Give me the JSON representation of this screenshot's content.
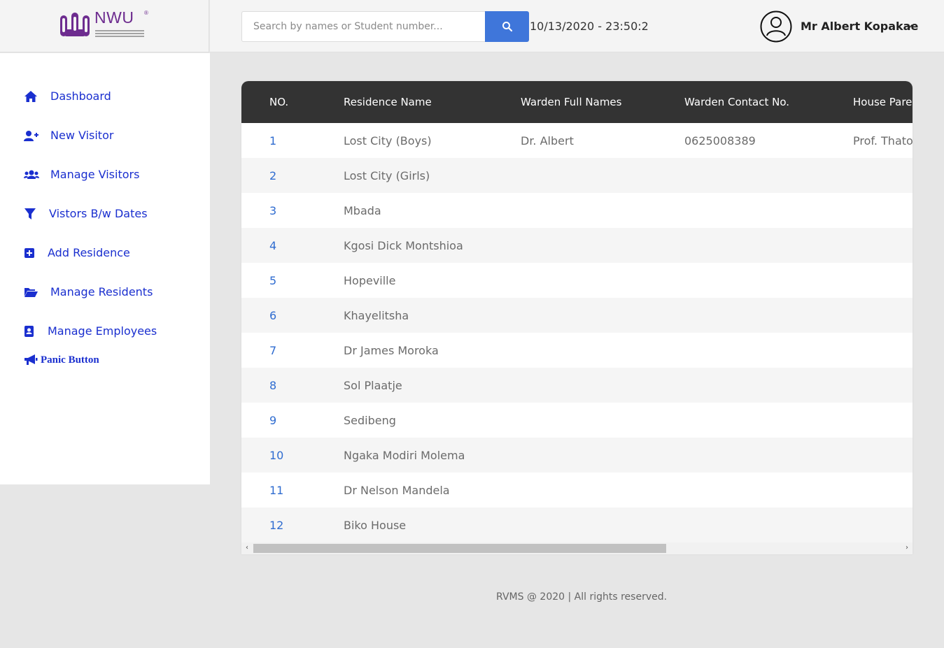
{
  "brand": {
    "name": "NWU",
    "reg_mark": "®"
  },
  "search": {
    "placeholder": "Search by names or Student number..."
  },
  "header": {
    "datetime": "10/13/2020 - 23:50:2",
    "user_name": "Mr Albert Kopakae"
  },
  "sidebar": {
    "items": [
      {
        "label": "Dashboard",
        "icon": "home-icon"
      },
      {
        "label": "New Visitor",
        "icon": "user-plus-icon"
      },
      {
        "label": "Manage Visitors",
        "icon": "users-icon"
      },
      {
        "label": "Vistors B/w Dates",
        "icon": "filter-icon"
      },
      {
        "label": "Add Residence",
        "icon": "plus-square-icon"
      },
      {
        "label": "Manage Residents",
        "icon": "folder-open-icon"
      },
      {
        "label": "Manage Employees",
        "icon": "address-book-icon"
      }
    ],
    "panic": {
      "label": "Panic Button",
      "icon": "megaphone-icon"
    }
  },
  "table": {
    "headers": [
      "NO.",
      "Residence Name",
      "Warden Full Names",
      "Warden Contact No.",
      "House Pare"
    ],
    "rows": [
      [
        "1",
        "Lost City (Boys)",
        "Dr. Albert",
        "0625008389",
        "Prof. Thato"
      ],
      [
        "2",
        "Lost City (Girls)",
        "",
        "",
        ""
      ],
      [
        "3",
        "Mbada",
        "",
        "",
        ""
      ],
      [
        "4",
        "Kgosi Dick Montshioa",
        "",
        "",
        ""
      ],
      [
        "5",
        "Hopeville",
        "",
        "",
        ""
      ],
      [
        "6",
        "Khayelitsha",
        "",
        "",
        ""
      ],
      [
        "7",
        "Dr James Moroka",
        "",
        "",
        ""
      ],
      [
        "8",
        "Sol Plaatje",
        "",
        "",
        ""
      ],
      [
        "9",
        "Sedibeng",
        "",
        "",
        ""
      ],
      [
        "10",
        "Ngaka Modiri Molema",
        "",
        "",
        ""
      ],
      [
        "11",
        "Dr Nelson Mandela",
        "",
        "",
        ""
      ],
      [
        "12",
        "Biko House",
        "",
        "",
        ""
      ]
    ]
  },
  "footer": {
    "text": "RVMS @ 2020 | All rights reserved."
  },
  "colors": {
    "accent": "#3f76da",
    "nav": "#1a2fcf",
    "header_bg": "#333333",
    "brand": "#6d2c8f"
  }
}
